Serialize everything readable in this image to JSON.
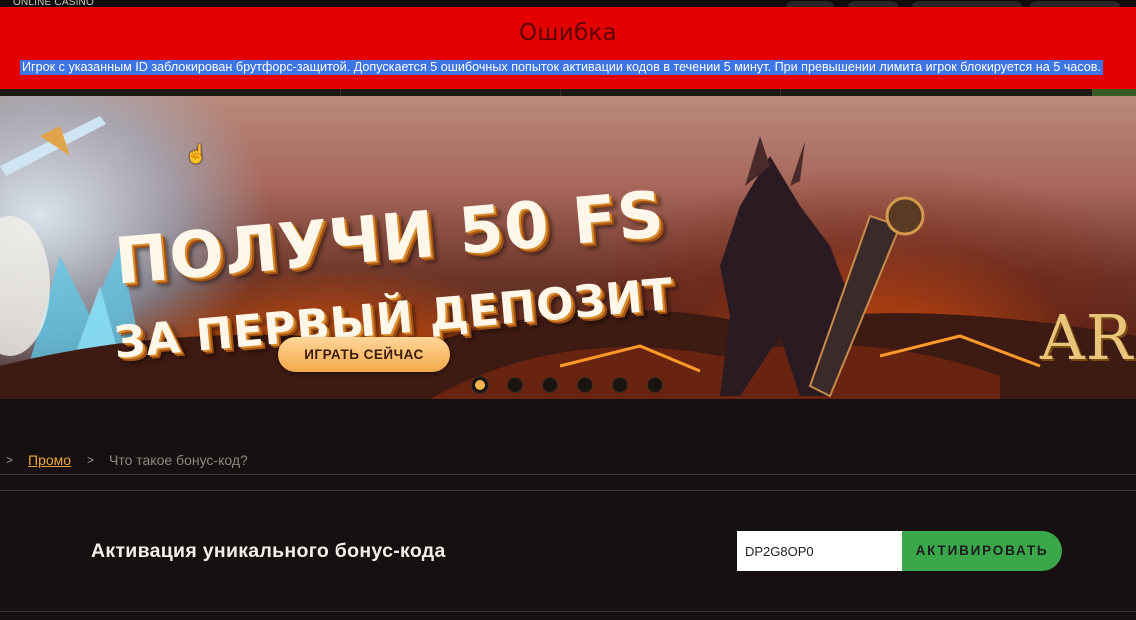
{
  "header": {
    "brand": "ONLINE CASINO"
  },
  "error": {
    "title": "Ошибка",
    "message": "Игрок с указанным ID заблокирован брутфорс-защитой. Допускается 5 ошибочных попыток активации кодов в течении 5 минут. При превышении лимита игрок блокируется на 5 часов."
  },
  "banner": {
    "line1": "ПОЛУЧИ 50 FS",
    "line2": "ЗА ПЕРВЫЙ ДЕПОЗИТ",
    "button": "ИГРАТЬ СЕЙЧАС",
    "logo_text": "ARO",
    "slides_count": 6,
    "active_slide": 1
  },
  "breadcrumb": {
    "separator": ">",
    "link": "Промо",
    "current": "Что такое бонус-код?"
  },
  "activation": {
    "title": "Активация уникального бонус-кода",
    "code_value": "DP2G8OP0",
    "button": "АКТИВИРОВАТЬ"
  },
  "colors": {
    "error_bg": "#e50000",
    "accent": "#f0a43a",
    "activate_green": "#3aa74a",
    "page_bg": "#161110"
  }
}
